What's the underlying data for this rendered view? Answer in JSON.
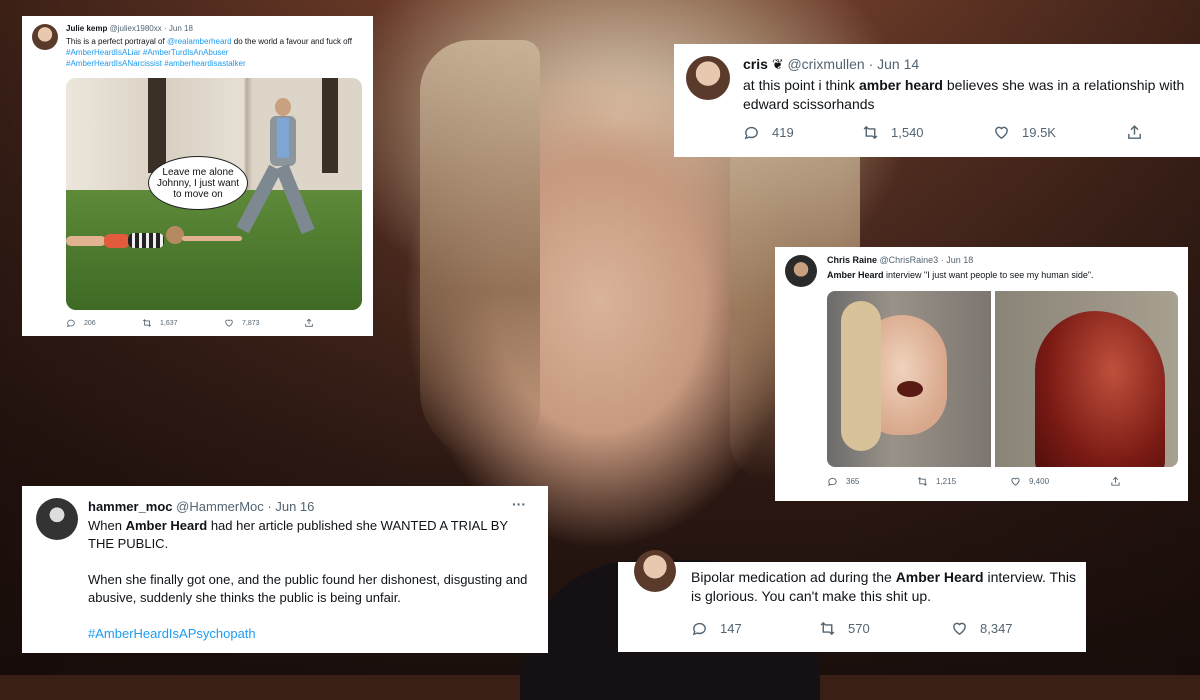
{
  "tweet1": {
    "name": "Julie kemp",
    "handle": "@juliex1980xx",
    "dot": "·",
    "date": "Jun 18",
    "text_a": "This is a perfect portrayal of ",
    "mention": "@realamberheard",
    "text_b": " do the world a favour and fuck off ",
    "tags_line1": "#AmberHeardIsALiar #AmberTurdIsAnAbuser",
    "tags_line2": "#AmberHeardIsANarcissist #amberheardisastalker",
    "bubble_text": "Leave me alone Johnny, I just want to move on",
    "replies": "206",
    "retweets": "1,637",
    "likes": "7,873"
  },
  "tweet2": {
    "name": "cris",
    "badge": "❦",
    "handle": "@crixmullen",
    "dot": "·",
    "date": "Jun 14",
    "text_a": "at this point i think ",
    "text_bold": "amber heard",
    "text_b": " believes she was in a relationship with edward scissorhands",
    "replies": "419",
    "retweets": "1,540",
    "likes": "19.5K"
  },
  "tweet3": {
    "name": "Chris Raine",
    "handle": "@ChrisRaine3",
    "dot": "·",
    "date": "Jun 18",
    "text_bold": "Amber Heard",
    "text_b": " interview \"I just want people to see my human side\".",
    "replies": "365",
    "retweets": "1,215",
    "likes": "9,400"
  },
  "tweet4": {
    "name": "hammer_moc",
    "handle": "@HammerMoc",
    "dot": "·",
    "date": "Jun 16",
    "more": "···",
    "p1_a": "When ",
    "p1_bold": "Amber Heard",
    "p1_b": " had her article published she WANTED A TRIAL BY THE PUBLIC.",
    "p2": "When she finally got one, and the public found her dishonest, disgusting and abusive, suddenly she thinks the public is being unfair.",
    "tag": "#AmberHeardIsAPsychopath"
  },
  "tweet5": {
    "text_a": "Bipolar medication ad during the ",
    "text_bold": "Amber Heard",
    "text_b": " interview. This is glorious. You can't make this shit up.",
    "replies": "147",
    "retweets": "570",
    "likes": "8,347"
  },
  "colors": {
    "link": "#1d9bf0",
    "muted": "#536471",
    "text": "#0f1419"
  }
}
